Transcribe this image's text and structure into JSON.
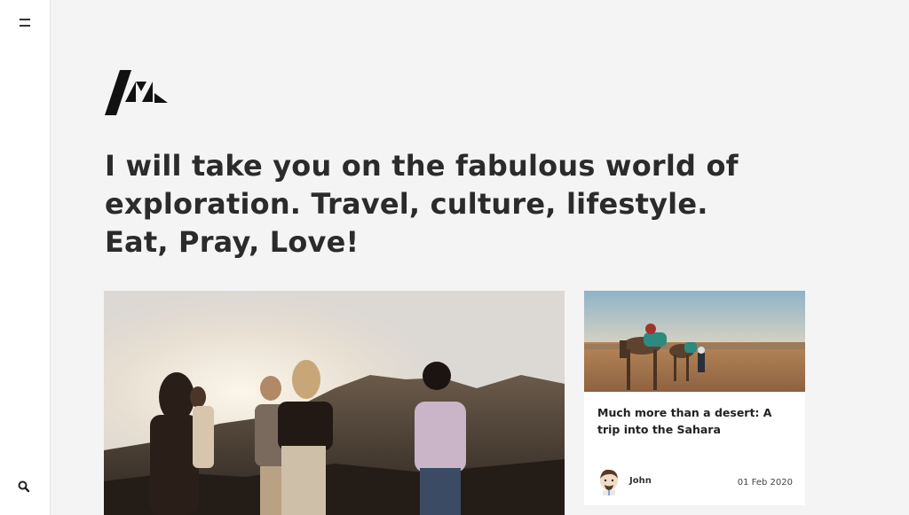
{
  "sidebar": {
    "menu_icon": "menu-icon",
    "search_icon": "search-icon"
  },
  "logo": {
    "name": "site-logo"
  },
  "hero": {
    "headline": "I will take you on the fabulous world of exploration. Travel, culture, lifestyle. Eat, Pray, Love!"
  },
  "posts": [
    {
      "image": "friends at sunset in hills",
      "title": ""
    },
    {
      "image": "camels in the desert",
      "title": "Much more than a desert: A trip into the Sahara",
      "author": "John",
      "date": "01 Feb 2020"
    }
  ],
  "colors": {
    "background": "#f4f4f4",
    "sidebar": "#ffffff",
    "text": "#2b2b2b"
  }
}
